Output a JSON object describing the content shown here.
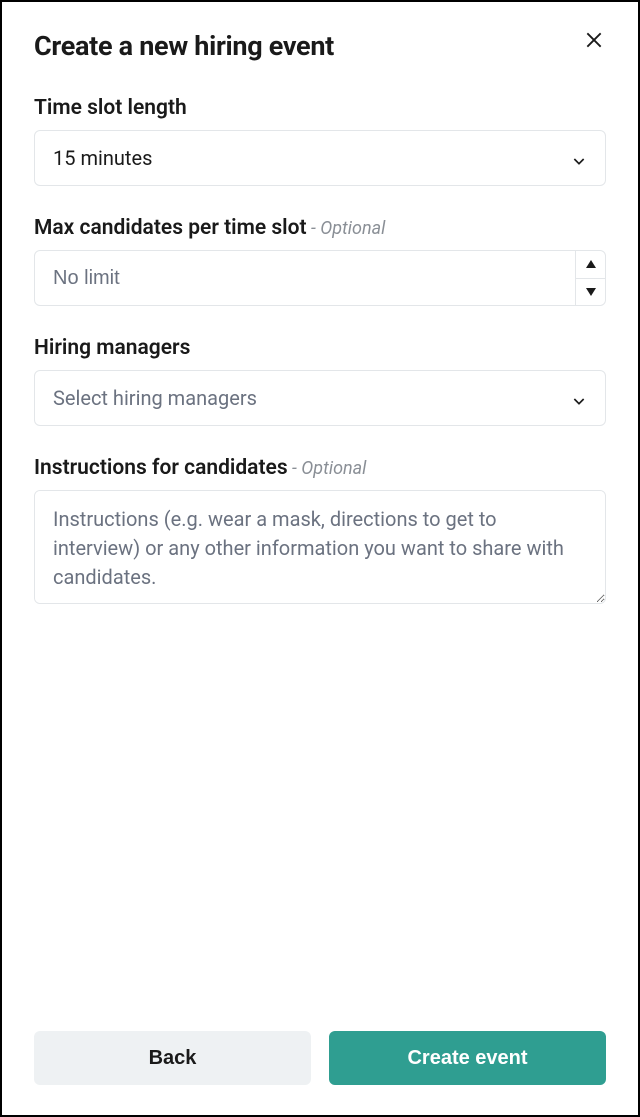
{
  "header": {
    "title": "Create a new hiring event"
  },
  "fields": {
    "timeSlot": {
      "label": "Time slot length",
      "value": "15 minutes"
    },
    "maxCandidates": {
      "label": "Max candidates per time slot",
      "optional": " - Optional",
      "placeholder": "No limit",
      "value": ""
    },
    "hiringManagers": {
      "label": "Hiring managers",
      "placeholder": "Select hiring managers"
    },
    "instructions": {
      "label": "Instructions for candidates",
      "optional": " - Optional",
      "placeholder": "Instructions (e.g. wear a mask, directions to get to interview) or any other information you want to share with candidates.",
      "value": ""
    }
  },
  "footer": {
    "back": "Back",
    "create": "Create event"
  }
}
